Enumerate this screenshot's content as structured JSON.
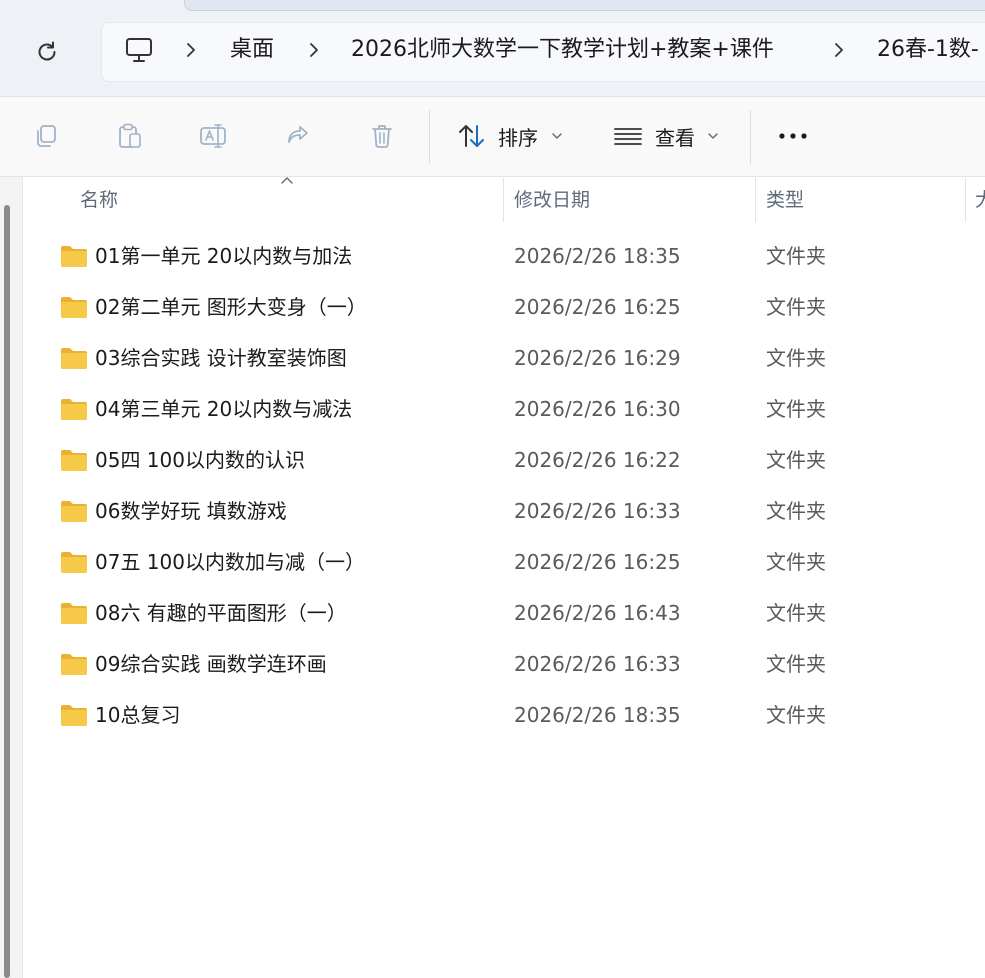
{
  "breadcrumb": {
    "items": [
      "桌面",
      "2026北师大数学一下教学计划+教案+课件",
      "26春-1数-"
    ]
  },
  "toolbar": {
    "sort_label": "排序",
    "view_label": "查看",
    "more_label": "•••"
  },
  "columns": {
    "name": "名称",
    "modified": "修改日期",
    "type": "类型",
    "size": "大"
  },
  "files": [
    {
      "name": "01第一单元 20以内数与加法",
      "modified": "2026/2/26 18:35",
      "type": "文件夹"
    },
    {
      "name": "02第二单元 图形大变身（一）",
      "modified": "2026/2/26 16:25",
      "type": "文件夹"
    },
    {
      "name": "03综合实践 设计教室装饰图",
      "modified": "2026/2/26 16:29",
      "type": "文件夹"
    },
    {
      "name": "04第三单元 20以内数与减法",
      "modified": "2026/2/26 16:30",
      "type": "文件夹"
    },
    {
      "name": "05四 100以内数的认识",
      "modified": "2026/2/26 16:22",
      "type": "文件夹"
    },
    {
      "name": "06数学好玩 填数游戏",
      "modified": "2026/2/26 16:33",
      "type": "文件夹"
    },
    {
      "name": "07五 100以内数加与减（一）",
      "modified": "2026/2/26 16:25",
      "type": "文件夹"
    },
    {
      "name": "08六 有趣的平面图形（一）",
      "modified": "2026/2/26 16:43",
      "type": "文件夹"
    },
    {
      "name": "09综合实践 画数学连环画",
      "modified": "2026/2/26 16:33",
      "type": "文件夹"
    },
    {
      "name": "10总复习",
      "modified": "2026/2/26 18:35",
      "type": "文件夹"
    }
  ],
  "colors": {
    "folder": "#f7c948",
    "folder_tab": "#e9b233",
    "accent": "#005fb8"
  }
}
